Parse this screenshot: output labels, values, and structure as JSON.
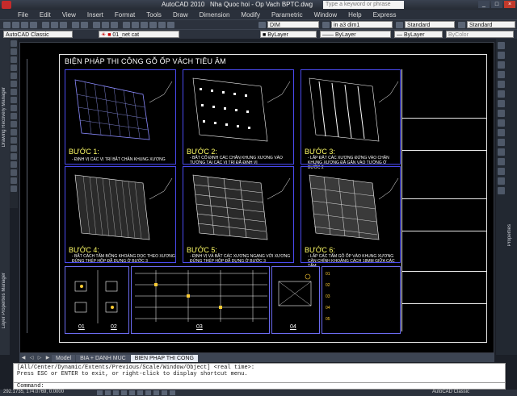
{
  "window": {
    "app_title": "AutoCAD 2010",
    "file_title": "Nha Quoc hoi - Op Vach BPTC.dwg",
    "search_placeholder": "Type a keyword or phrase"
  },
  "menu": [
    "File",
    "Edit",
    "View",
    "Insert",
    "Format",
    "Tools",
    "Draw",
    "Dimension",
    "Modify",
    "Parametric",
    "Window",
    "Help",
    "Express"
  ],
  "toolbar": {
    "dimstyle": "DIM",
    "dimstyle2": "in a3 dim1",
    "textstyle": "Standard",
    "tablestyle": "Standard",
    "workspace": "AutoCAD Classic",
    "layer": "01_net cat",
    "color": "ByLayer",
    "linetype": "ByLayer",
    "lineweight": "ByLayer",
    "plotstyle": "ByColor"
  },
  "side_panels": {
    "left_top": "Drawing Recovery Manager",
    "left_bottom": "Layer Properties Manager",
    "right": "Properties"
  },
  "drawing": {
    "sheet_title": "BIỆN PHÁP THI CÔNG GỖ ỐP VÁCH TIÊU ÂM",
    "steps": [
      {
        "label": "BƯỚC 1:",
        "desc": "- ĐỊNH VỊ CÁC VỊ TRÍ BẮT CHÂN KHUNG XƯƠNG"
      },
      {
        "label": "BƯỚC 2:",
        "desc": "- BẮT CỐ ĐỊNH CÁC CHÂN KHUNG XƯƠNG  VÀO TƯỜNG TẠI CÁC VỊ TRÍ ĐÃ ĐỊNH VỊ"
      },
      {
        "label": "BƯỚC 3:",
        "desc": "- LẮP ĐẶT CÁC XƯƠNG ĐỨNG VÀO CHÂN KHUNG XƯƠNG ĐÃ GẮN VÀO TƯỜNG Ở BƯỚC 2"
      },
      {
        "label": "BƯỚC 4:",
        "desc": "- BẮT CÁCH TẤM BÔNG KHOÁNG DỌC THEO XƯƠNG ĐỨNG THÉP HỘP ĐÃ DỰNG Ở BƯỚC 3"
      },
      {
        "label": "BƯỚC 5:",
        "desc": "- ĐỊNH VỊ VÀ BẮT CÁC XƯƠNG NGANG VỚI XƯƠNG ĐỨNG THÉP HỘP ĐÃ DỰNG Ở BƯỚC 3"
      },
      {
        "label": "BƯỚC 6:",
        "desc": "- LẮP CÁC TẤM GỖ ỐP VÀO KHUNG XƯƠNG CĂN CHỈNH KHOẢNG CÁCH 18MM GIỮA CÁC TẤM"
      }
    ],
    "details": [
      "01",
      "02",
      "03",
      "04"
    ],
    "detail_notes": [
      "01",
      "02",
      "03",
      "04",
      "05"
    ]
  },
  "layout_tabs": [
    "Model",
    "BIA + DANH MUC",
    "BIEN PHAP THI CONG"
  ],
  "command": {
    "history_line1": "[All/Center/Dynamic/Extents/Previous/Scale/Window/Object] <real time>:",
    "history_line2": "Press ESC or ENTER to exit, or right-click to display shortcut menu.",
    "prompt": "Command:"
  },
  "status": {
    "coordinates": "292.1735, 174.0769, 0.0000",
    "workspace": "AutoCAD Classic"
  },
  "colors": {
    "model_space": "#000000",
    "step_label": "#fffd66",
    "panel_border": "#4a4af0",
    "sheet_border": "#e8e8e8"
  }
}
